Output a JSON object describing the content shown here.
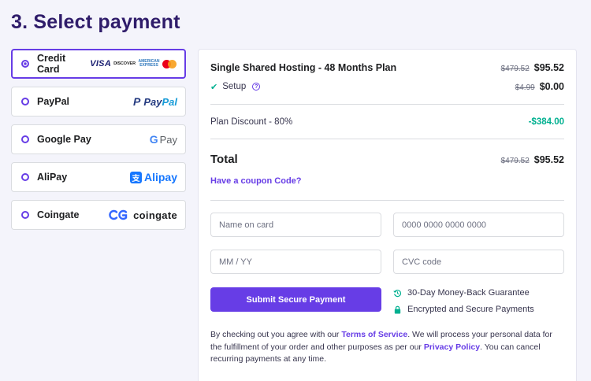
{
  "page": {
    "title": "3. Select payment"
  },
  "methods": [
    {
      "label": "Credit Card",
      "selected": true,
      "brand": {
        "visa": "VISA",
        "discover": "DISCOVER",
        "amex": "AMERICAN EXPRESS"
      }
    },
    {
      "label": "PayPal",
      "selected": false,
      "brand": {
        "text1": "Pay",
        "text2": "Pal",
        "mark": "P"
      }
    },
    {
      "label": "Google Pay",
      "selected": false,
      "brand": {
        "mark": "G",
        "text": "Pay"
      }
    },
    {
      "label": "AliPay",
      "selected": false,
      "brand": {
        "mark": "支",
        "text": "Alipay"
      }
    },
    {
      "label": "Coingate",
      "selected": false,
      "brand": {
        "text": "coingate"
      }
    }
  ],
  "summary": {
    "plan": {
      "name": "Single Shared Hosting - 48 Months Plan",
      "old_price": "$479.52",
      "price": "$95.52"
    },
    "setup": {
      "label": "Setup",
      "old_price": "$4.99",
      "price": "$0.00"
    },
    "discount": {
      "label": "Plan Discount - 80%",
      "value": "-$384.00"
    },
    "total": {
      "label": "Total",
      "old_price": "$479.52",
      "price": "$95.52"
    },
    "coupon_link": "Have a coupon Code?"
  },
  "form": {
    "name_placeholder": "Name on card",
    "number_placeholder": "0000 0000 0000 0000",
    "expiry_placeholder": "MM / YY",
    "cvc_placeholder": "CVC code",
    "submit_label": "Submit Secure Payment"
  },
  "guarantees": {
    "money_back": "30-Day Money-Back Guarantee",
    "secure": "Encrypted and Secure Payments"
  },
  "legal": {
    "part1": "By checking out you agree with our ",
    "tos": "Terms of Service",
    "part2": ". We will process your personal data for the fulfillment of your order and other purposes as per our ",
    "privacy": "Privacy Policy",
    "part3": ". You can cancel recurring payments at any time."
  },
  "colors": {
    "accent": "#673de6",
    "success": "#00b090",
    "heading": "#2f1c6a"
  }
}
